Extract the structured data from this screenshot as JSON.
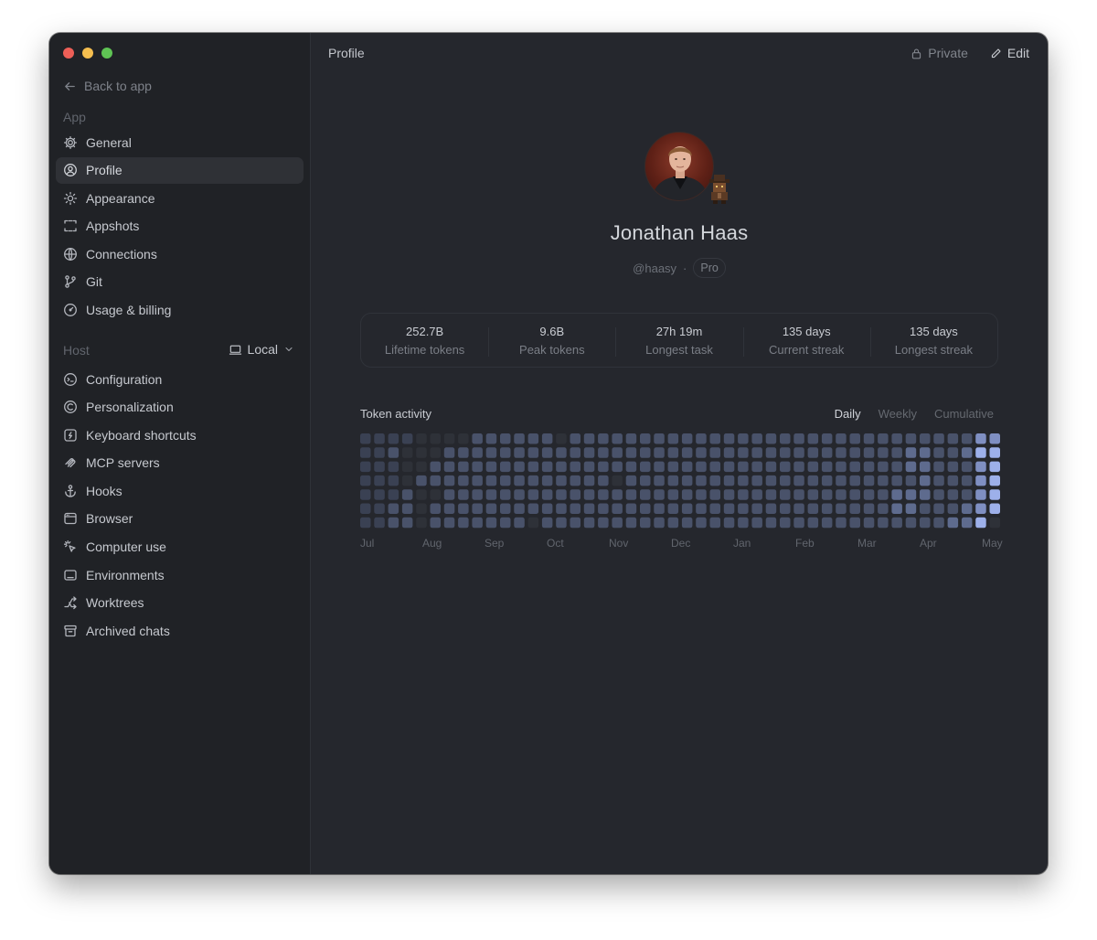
{
  "window": {
    "traffic_lights": {
      "close": "#ed5f57",
      "minimize": "#f5be4f",
      "zoom": "#5fc454"
    }
  },
  "sidebar": {
    "back_label": "Back to app",
    "app_section_label": "App",
    "app_items": [
      {
        "label": "General",
        "icon": "gear-icon"
      },
      {
        "label": "Profile",
        "icon": "user-circle-icon",
        "active": true
      },
      {
        "label": "Appearance",
        "icon": "sun-icon"
      },
      {
        "label": "Appshots",
        "icon": "screenshot-frame-icon"
      },
      {
        "label": "Connections",
        "icon": "globe-icon"
      },
      {
        "label": "Git",
        "icon": "git-branch-icon"
      },
      {
        "label": "Usage & billing",
        "icon": "gauge-icon"
      }
    ],
    "host_section_label": "Host",
    "host_select": {
      "value": "Local",
      "icon": "laptop-icon"
    },
    "host_items": [
      {
        "label": "Configuration",
        "icon": "config-icon"
      },
      {
        "label": "Personalization",
        "icon": "personalization-icon"
      },
      {
        "label": "Keyboard shortcuts",
        "icon": "keyboard-shortcut-icon"
      },
      {
        "label": "MCP servers",
        "icon": "mcp-icon"
      },
      {
        "label": "Hooks",
        "icon": "anchor-icon"
      },
      {
        "label": "Browser",
        "icon": "browser-icon"
      },
      {
        "label": "Computer use",
        "icon": "cursor-click-icon"
      },
      {
        "label": "Environments",
        "icon": "monitor-icon"
      },
      {
        "label": "Worktrees",
        "icon": "worktree-icon"
      },
      {
        "label": "Archived chats",
        "icon": "archive-icon"
      }
    ]
  },
  "header": {
    "title": "Profile",
    "private_label": "Private",
    "edit_label": "Edit"
  },
  "profile": {
    "name": "Jonathan Haas",
    "handle": "@haasy",
    "separator": "·",
    "plan_badge": "Pro"
  },
  "stats": [
    {
      "value": "252.7B",
      "label": "Lifetime tokens"
    },
    {
      "value": "9.6B",
      "label": "Peak tokens"
    },
    {
      "value": "27h 19m",
      "label": "Longest task"
    },
    {
      "value": "135 days",
      "label": "Current streak"
    },
    {
      "value": "135 days",
      "label": "Longest streak"
    }
  ],
  "activity": {
    "title": "Token activity",
    "tabs": [
      {
        "label": "Daily",
        "active": true
      },
      {
        "label": "Weekly",
        "active": false
      },
      {
        "label": "Cumulative",
        "active": false
      }
    ],
    "months": [
      "Jul",
      "Aug",
      "Sep",
      "Oct",
      "Nov",
      "Dec",
      "Jan",
      "Feb",
      "Mar",
      "Apr",
      "May"
    ],
    "level_colors": [
      "#2e3138",
      "#3a4153",
      "#49526a",
      "#5e6b8e",
      "#7f8fc2",
      "#9db0ea"
    ],
    "levels": [
      "1111000022222202222222222222222222222222222244",
      "1120002222222222222222222222222222222223322355",
      "1110022222222222222222222222222222222223322245",
      "1110222222222222220222222222222222222222322245",
      "1112002222222222222222222222222222222233322245",
      "1122022222222222222222222222222222222233222345",
      "1122022222220222222222222222222222222222223350"
    ]
  }
}
